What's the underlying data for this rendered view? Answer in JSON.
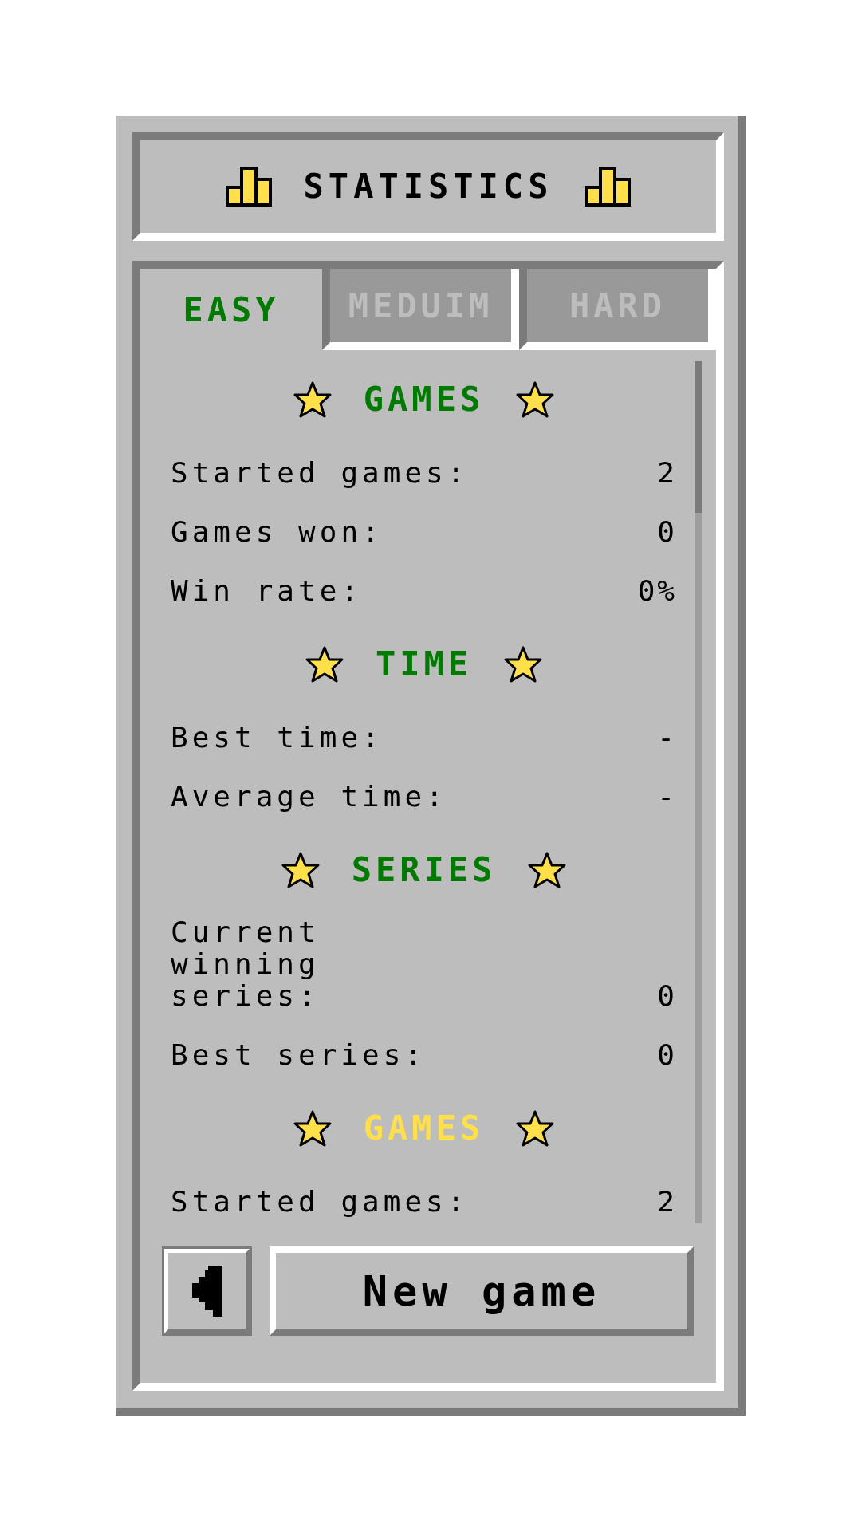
{
  "title": "STATISTICS",
  "tabs": [
    {
      "label": "EASY",
      "selected": true
    },
    {
      "label": "MEDUIM",
      "selected": false
    },
    {
      "label": "HARD",
      "selected": false
    }
  ],
  "sections": [
    {
      "title": "GAMES",
      "color": "#007a00",
      "rows": [
        {
          "label": "Started games:",
          "value": "2"
        },
        {
          "label": "Games won:",
          "value": "0"
        },
        {
          "label": "Win rate:",
          "value": "0%"
        }
      ]
    },
    {
      "title": "TIME",
      "color": "#007a00",
      "rows": [
        {
          "label": "Best time:",
          "value": "-"
        },
        {
          "label": "Average time:",
          "value": "-"
        }
      ]
    },
    {
      "title": "SERIES",
      "color": "#007a00",
      "rows": [
        {
          "label": "Current winning series:",
          "value": "0"
        },
        {
          "label": "Best series:",
          "value": "0"
        }
      ]
    },
    {
      "title": "GAMES",
      "color": "#ffdf4a",
      "rows": [
        {
          "label": "Started games:",
          "value": "2"
        }
      ]
    }
  ],
  "new_game_button": "New game"
}
